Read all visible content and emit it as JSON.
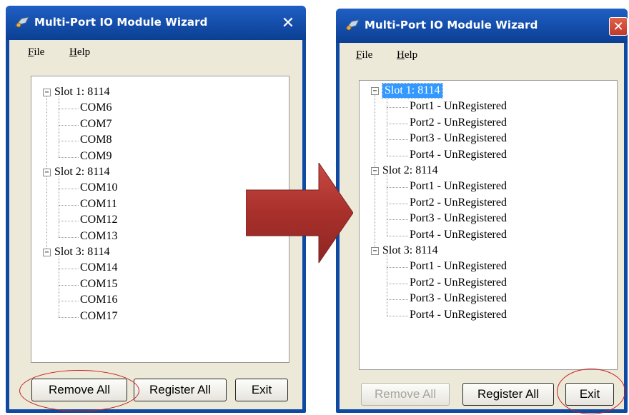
{
  "colors": {
    "window_frame": "#0e4aa3",
    "client_bg": "#ece9d8",
    "selection": "#3399ff",
    "arrow": "#b73a35",
    "highlight": "#c8201c"
  },
  "window_left": {
    "title": "Multi-Port IO Module Wizard",
    "close_glyph": "✕",
    "menu": {
      "file": {
        "first": "F",
        "rest": "ile"
      },
      "help": {
        "first": "H",
        "rest": "elp"
      }
    },
    "tree": [
      {
        "label": "Slot 1: 8114",
        "expander": "−",
        "children": [
          "COM6",
          "COM7",
          "COM8",
          "COM9"
        ]
      },
      {
        "label": "Slot 2: 8114",
        "expander": "−",
        "children": [
          "COM10",
          "COM11",
          "COM12",
          "COM13"
        ]
      },
      {
        "label": "Slot 3: 8114",
        "expander": "−",
        "children": [
          "COM14",
          "COM15",
          "COM16",
          "COM17"
        ]
      }
    ],
    "buttons": {
      "remove_all": "Remove All",
      "register_all": "Register All",
      "exit": "Exit"
    }
  },
  "window_right": {
    "title": "Multi-Port IO Module Wizard",
    "close_glyph": "✕",
    "menu": {
      "file": {
        "first": "F",
        "rest": "ile"
      },
      "help": {
        "first": "H",
        "rest": "elp"
      }
    },
    "tree": [
      {
        "label": "Slot 1: 8114",
        "expander": "−",
        "selected": true,
        "children": [
          "Port1 - UnRegistered",
          "Port2 - UnRegistered",
          "Port3 - UnRegistered",
          "Port4 - UnRegistered"
        ]
      },
      {
        "label": "Slot 2: 8114",
        "expander": "−",
        "children": [
          "Port1 - UnRegistered",
          "Port2 - UnRegistered",
          "Port3 - UnRegistered",
          "Port4 - UnRegistered"
        ]
      },
      {
        "label": "Slot 3: 8114",
        "expander": "−",
        "children": [
          "Port1 - UnRegistered",
          "Port2 - UnRegistered",
          "Port3 - UnRegistered",
          "Port4 - UnRegistered"
        ]
      }
    ],
    "buttons": {
      "remove_all": "Remove All",
      "register_all": "Register All",
      "exit": "Exit",
      "remove_all_disabled": true
    }
  },
  "icons": [
    "wizard-app-icon",
    "close-icon",
    "collapse-icon",
    "right-arrow-icon"
  ]
}
